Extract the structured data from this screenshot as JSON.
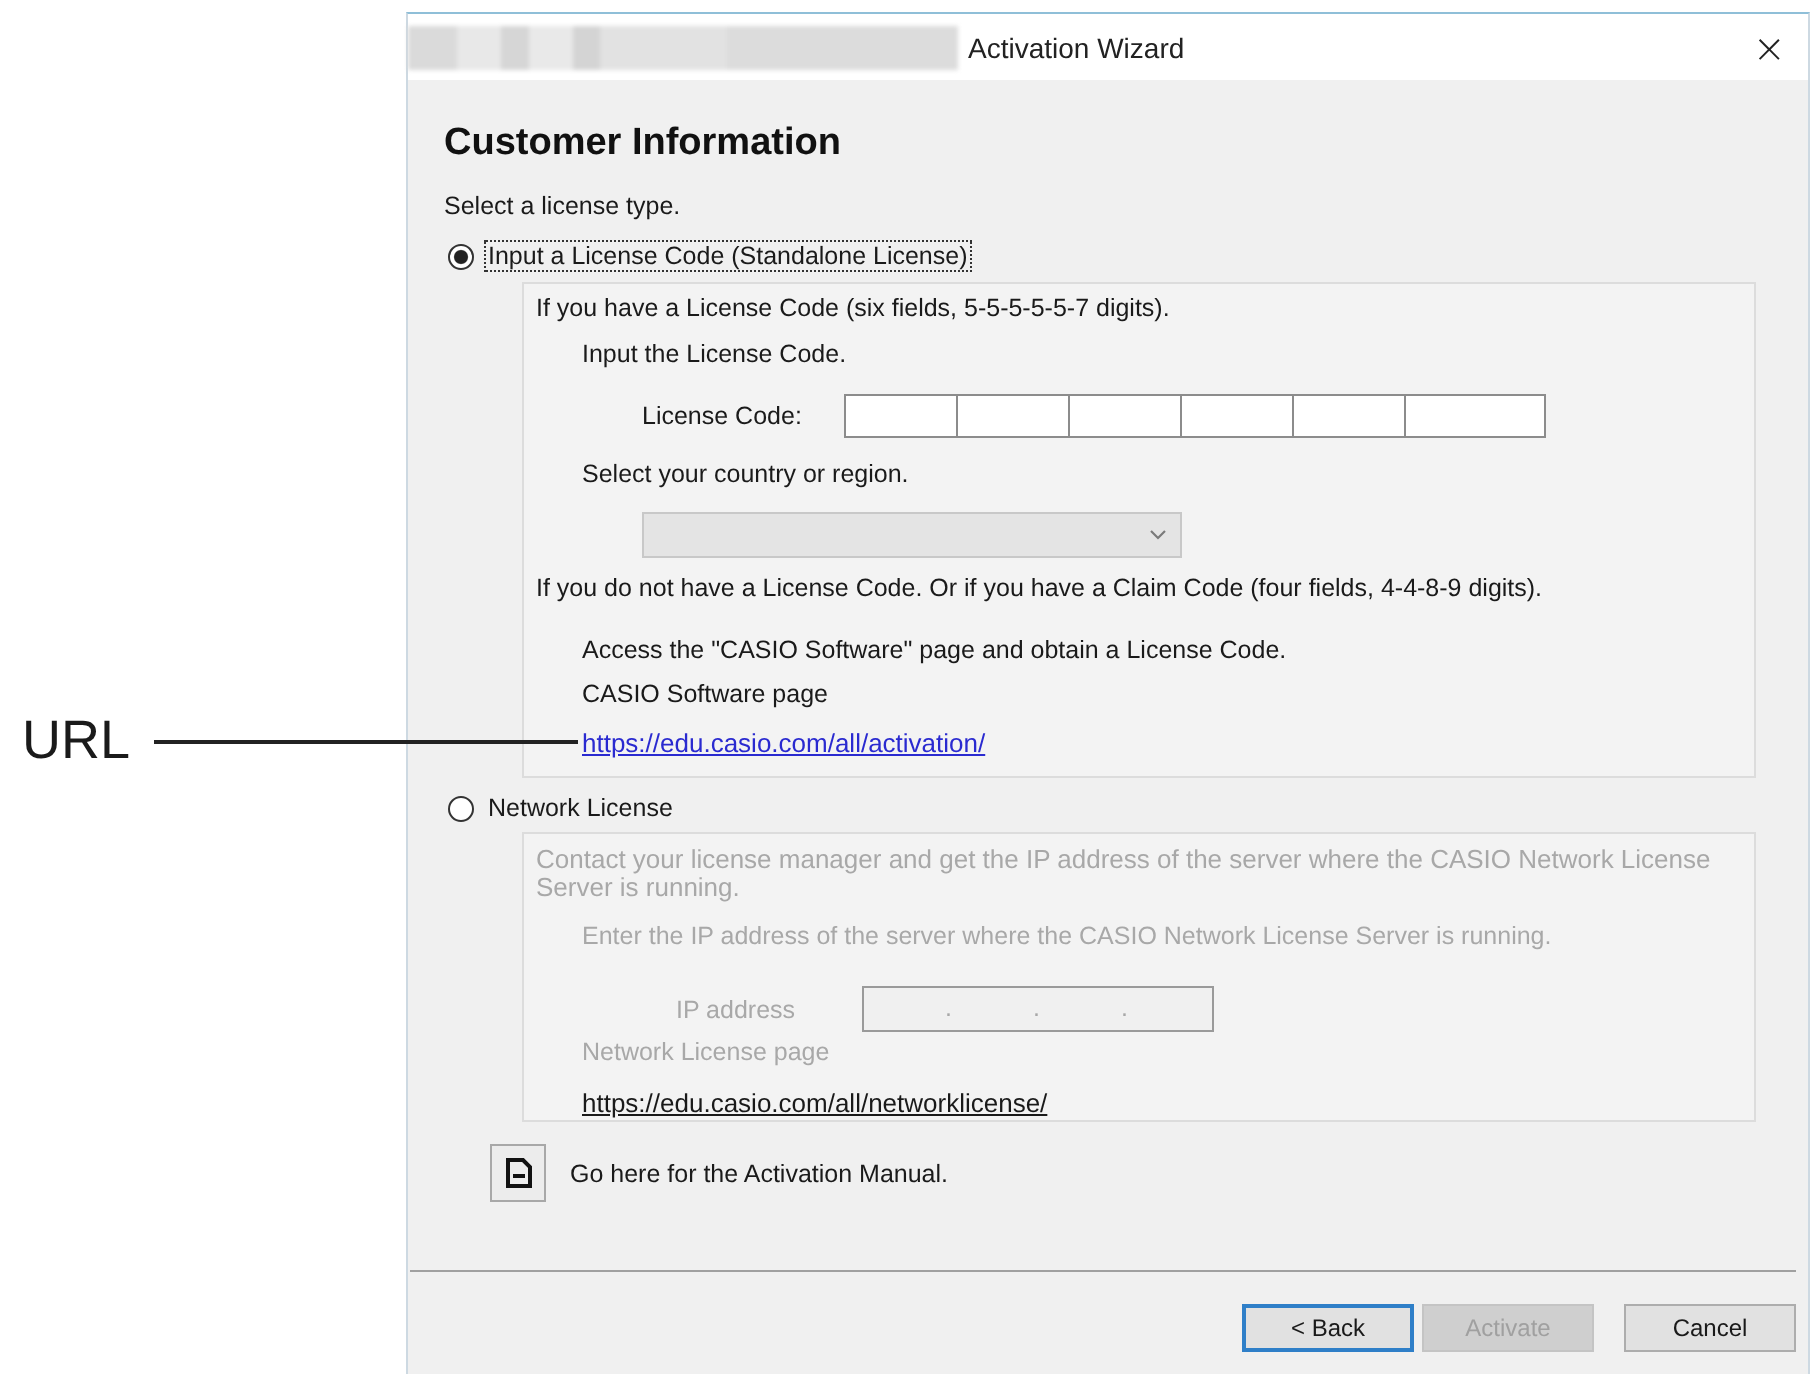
{
  "window": {
    "title": "Activation Wizard",
    "close": "×"
  },
  "heading": "Customer Information",
  "prompt": "Select a license type.",
  "standalone": {
    "label": "Input a License Code (Standalone License)",
    "selected": true,
    "focused": true,
    "disabled": false,
    "intro": "If you have a License Code (six fields, 5-5-5-5-5-7 digits).",
    "input_prompt": "Input the License Code.",
    "license_code": {
      "label": "License Code:",
      "fields": [
        {
          "disabled": false
        },
        {
          "disabled": false
        },
        {
          "disabled": false
        },
        {
          "disabled": false
        },
        {
          "disabled": false
        },
        {
          "disabled": false
        }
      ]
    },
    "country_prompt": "Select your country or region.",
    "country_select": {
      "disabled": true
    },
    "no_code_text": "If you do not have a License Code. Or if you have a Claim Code (four fields, 4-4-8-9 digits).",
    "access_text": "Access the \"CASIO Software\" page and obtain a License Code.",
    "page_label": "CASIO Software page",
    "link": "https://edu.casio.com/all/activation/"
  },
  "network": {
    "label": "Network License",
    "selected": false,
    "focused": false,
    "disabled": true,
    "contact_text": "Contact your license manager and get the IP address of the server where the CASIO Network License Server is running.",
    "enter_text": "Enter the IP address of the server where the CASIO Network License Server is running.",
    "ip_address": {
      "label": "IP address",
      "disabled": true,
      "separators": [
        ".",
        ".",
        "."
      ]
    },
    "page_label": "Network License page",
    "link": "https://edu.casio.com/all/networklicense/"
  },
  "manual": {
    "text": "Go here for the Activation Manual."
  },
  "buttons": [
    {
      "label": "< Back",
      "focused": true,
      "disabled": false
    },
    {
      "label": "Activate",
      "focused": false,
      "disabled": true
    },
    {
      "label": "Cancel",
      "focused": false,
      "disabled": false
    }
  ],
  "annotation": {
    "label": "URL"
  }
}
